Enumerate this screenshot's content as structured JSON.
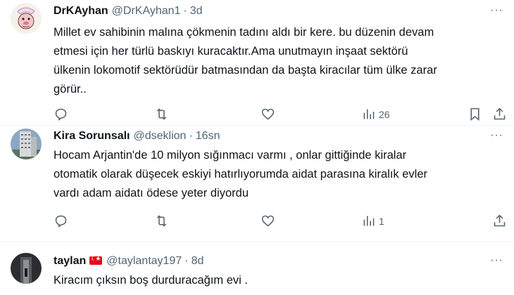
{
  "tweets": [
    {
      "name": "DrKAyhan",
      "handle": "@DrKAyhan1",
      "separator": "·",
      "time": "3d",
      "more": "···",
      "text": "Millet  ev sahibinin malına çökmenin tadını aldı bir kere. bu düzenin devam\netmesi için her türlü baskıyı kuracaktır.Ama unutmayın inşaat sektörü\nülkenin lokomotif sektörüdür batmasından da başta kiracılar tüm ülke zarar\ngörür..",
      "views": "26"
    },
    {
      "name": "Kira Sorunsalı",
      "handle": "@dseklion",
      "separator": "·",
      "time": "16sn",
      "more": "···",
      "text": "Hocam Arjantin'de 10 milyon sığınmacı varmı , onlar gittiğinde kiralar\notomatik olarak düşecek eskiyi hatırlıyorumda aidat parasına kiralık evler\nvardı adam aidatı ödese yeter diyordu",
      "views": "1"
    },
    {
      "name": "taylan",
      "handle": "@taylantay197",
      "separator": "·",
      "time": "8d",
      "more": "···",
      "text": "Kiracım çıksın boş durduracağım  evi ."
    }
  ],
  "colors": {
    "text": "#0f1419",
    "secondary": "#536471",
    "divider": "#eff3f4",
    "flag": "#e30a17"
  },
  "icons": [
    "reply-icon",
    "retweet-icon",
    "like-icon",
    "views-icon",
    "bookmark-icon",
    "share-icon",
    "more-icon",
    "turkey-flag-icon"
  ]
}
